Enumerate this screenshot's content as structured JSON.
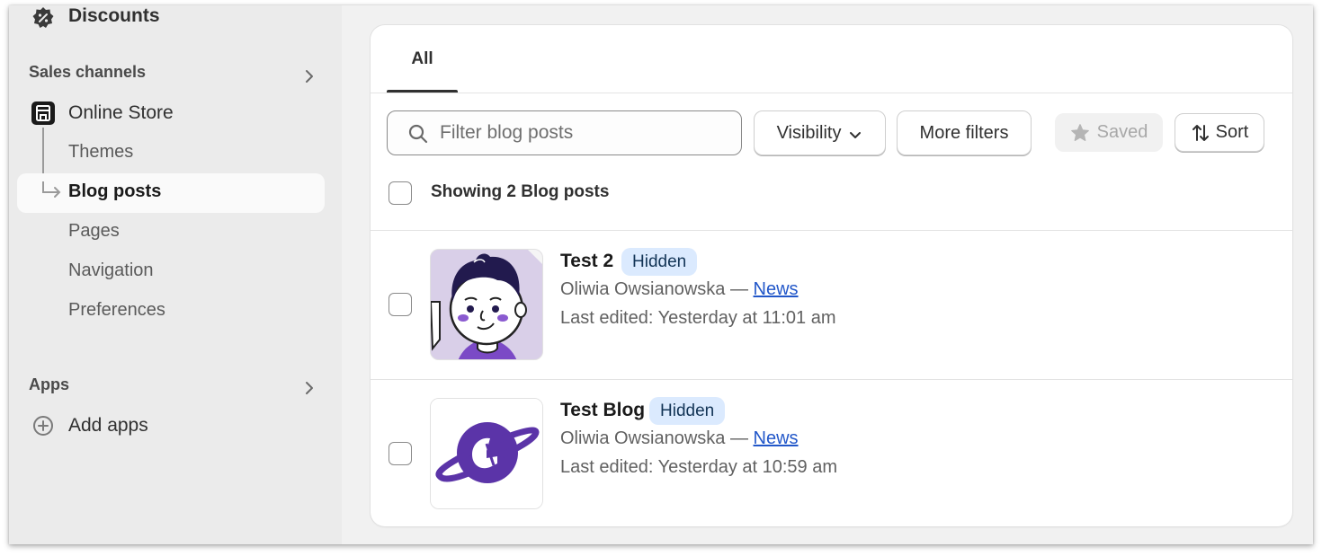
{
  "sidebar": {
    "discounts": {
      "label": "Discounts",
      "icon": "discount-icon"
    },
    "sales_channels": {
      "title": "Sales channels",
      "icon": "chevron-right-icon"
    },
    "online_store": {
      "label": "Online Store",
      "icon": "store-icon"
    },
    "sub_items": [
      {
        "label": "Themes",
        "active": false
      },
      {
        "label": "Blog posts",
        "active": true
      },
      {
        "label": "Pages",
        "active": false
      },
      {
        "label": "Navigation",
        "active": false
      },
      {
        "label": "Preferences",
        "active": false
      }
    ],
    "apps": {
      "title": "Apps",
      "icon": "chevron-right-icon"
    },
    "add_apps": {
      "label": "Add apps",
      "icon": "plus-circle-icon"
    }
  },
  "main": {
    "tabs": [
      {
        "label": "All",
        "selected": true
      }
    ],
    "search": {
      "placeholder": "Filter blog posts",
      "value": "",
      "icon": "search-icon"
    },
    "filters": {
      "visibility_label": "Visibility",
      "more_filters_label": "More filters",
      "saved_label": "Saved",
      "sort_label": "Sort"
    },
    "showing_text": "Showing 2 Blog posts",
    "posts": [
      {
        "title": "Test 2",
        "status": "Hidden",
        "author": "Oliwia Owsianowska",
        "separator": " — ",
        "blog": "News",
        "last_edited": "Last edited: Yesterday at 11:01 am",
        "thumbnail": "cartoon-avatar-image"
      },
      {
        "title": "Test Blog",
        "status": "Hidden",
        "author": "Oliwia Owsianowska",
        "separator": " — ",
        "blog": "News",
        "last_edited": "Last edited: Yesterday at 10:59 am",
        "thumbnail": "planet-logo-image"
      }
    ]
  },
  "colors": {
    "badge_bg": "#dbeafe",
    "link": "#2257c9",
    "accent_purple": "#5b34a8"
  }
}
